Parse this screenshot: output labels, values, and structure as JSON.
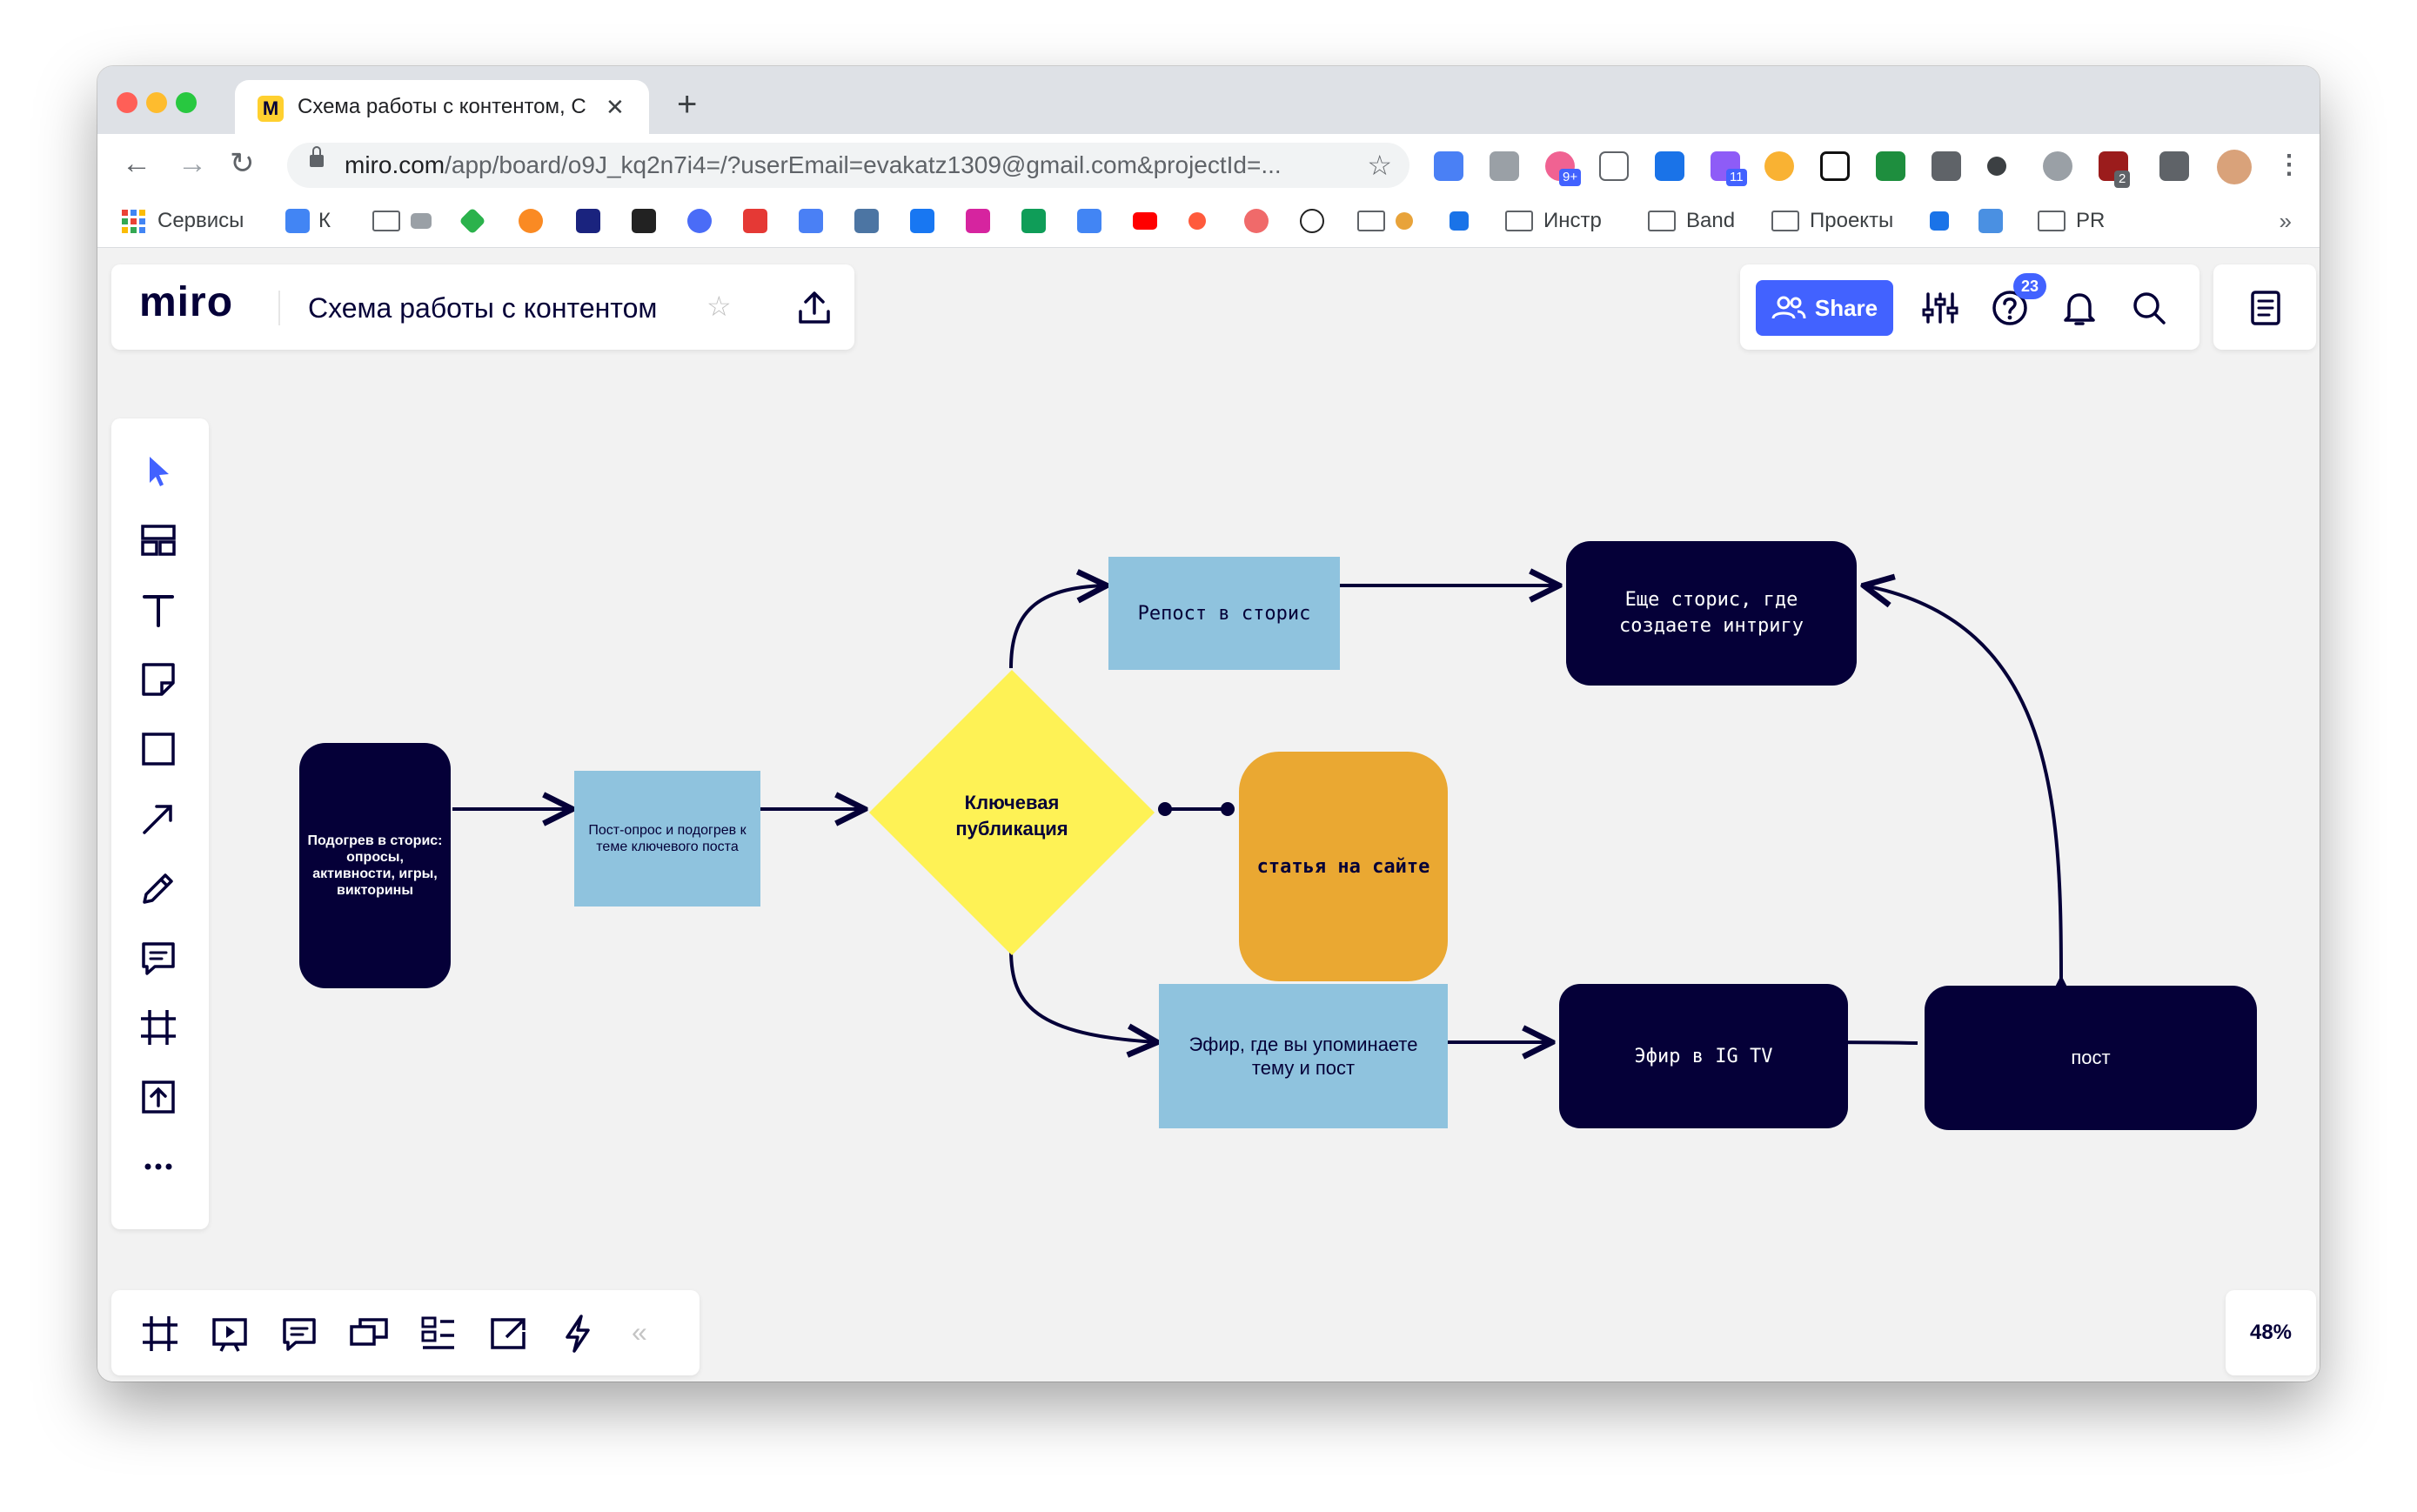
{
  "browser": {
    "tab": {
      "title": "Схема работы с контентом, С",
      "favicon_icon": "miro-favicon-icon",
      "close_icon": "close-icon"
    },
    "new_tab_label": "+",
    "url_host": "miro.com",
    "url_path": "/app/board/o9J_kq2n7i4=/?userEmail=evakatz1309@gmail.com&projectId=...",
    "extension_badges": {
      "first": "9+",
      "second": "11",
      "third": "2"
    },
    "bookmarks": {
      "apps": "Сервисы",
      "k": "К",
      "instr": "Инстр",
      "band": "Band",
      "projects": "Проекты",
      "pr": "PR",
      "more": "»"
    }
  },
  "miro": {
    "logo": "miro",
    "board_title": "Схема работы с контентом",
    "share_label": "Share",
    "help_badge": "23",
    "zoom": "48%",
    "collapse_label": "«"
  },
  "diagram": {
    "warmup": "Подогрев в сторис: опросы, активности, игры, викторины",
    "poll_post": "Пост-опрос и подогрев к теме ключевого поста",
    "key_pub": "Ключевая публикация",
    "repost": "Репост в сторис",
    "intrigue": "Еще сторис, где создаете интригу",
    "article": "статья на сайте",
    "live_mention": "Эфир, где вы упоминаете тему и пост",
    "igtv": "Эфир в IG TV",
    "post": "пост"
  },
  "colors": {
    "miro_blue": "#4262ff",
    "dark_navy": "#050038",
    "light_blue": "#8fc3de",
    "yellow": "#fef255",
    "orange": "#eaa832",
    "canvas": "#f2f2f2"
  }
}
